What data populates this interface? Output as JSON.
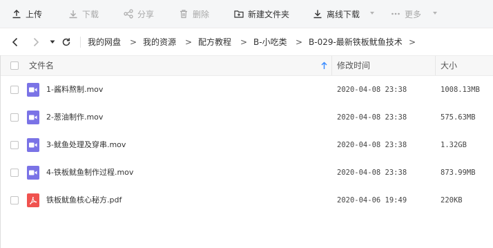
{
  "toolbar": {
    "upload": "上传",
    "download": "下载",
    "share": "分享",
    "delete": "删除",
    "new_folder": "新建文件夹",
    "offline_download": "离线下载",
    "more": "更多"
  },
  "breadcrumb": [
    "我的网盘",
    "我的资源",
    "配方教程",
    "B-小吃类",
    "B-029-最新铁板鱿鱼技术"
  ],
  "columns": {
    "name": "文件名",
    "modified": "修改时间",
    "size": "大小"
  },
  "files": [
    {
      "name": "1-酱料熬制.mov",
      "modified": "2020-04-08 23:38",
      "size": "1008.13MB",
      "type": "video"
    },
    {
      "name": "2-葱油制作.mov",
      "modified": "2020-04-08 23:38",
      "size": "575.63MB",
      "type": "video"
    },
    {
      "name": "3-鱿鱼处理及穿串.mov",
      "modified": "2020-04-08 23:38",
      "size": "1.32GB",
      "type": "video"
    },
    {
      "name": "4-铁板鱿鱼制作过程.mov",
      "modified": "2020-04-08 23:38",
      "size": "873.99MB",
      "type": "video"
    },
    {
      "name": "铁板鱿鱼核心秘方.pdf",
      "modified": "2020-04-06 19:49",
      "size": "220KB",
      "type": "pdf"
    }
  ],
  "colors": {
    "video_icon": "#7a73e6",
    "pdf_icon": "#f0524f",
    "sort_arrow": "#3b8cff"
  }
}
